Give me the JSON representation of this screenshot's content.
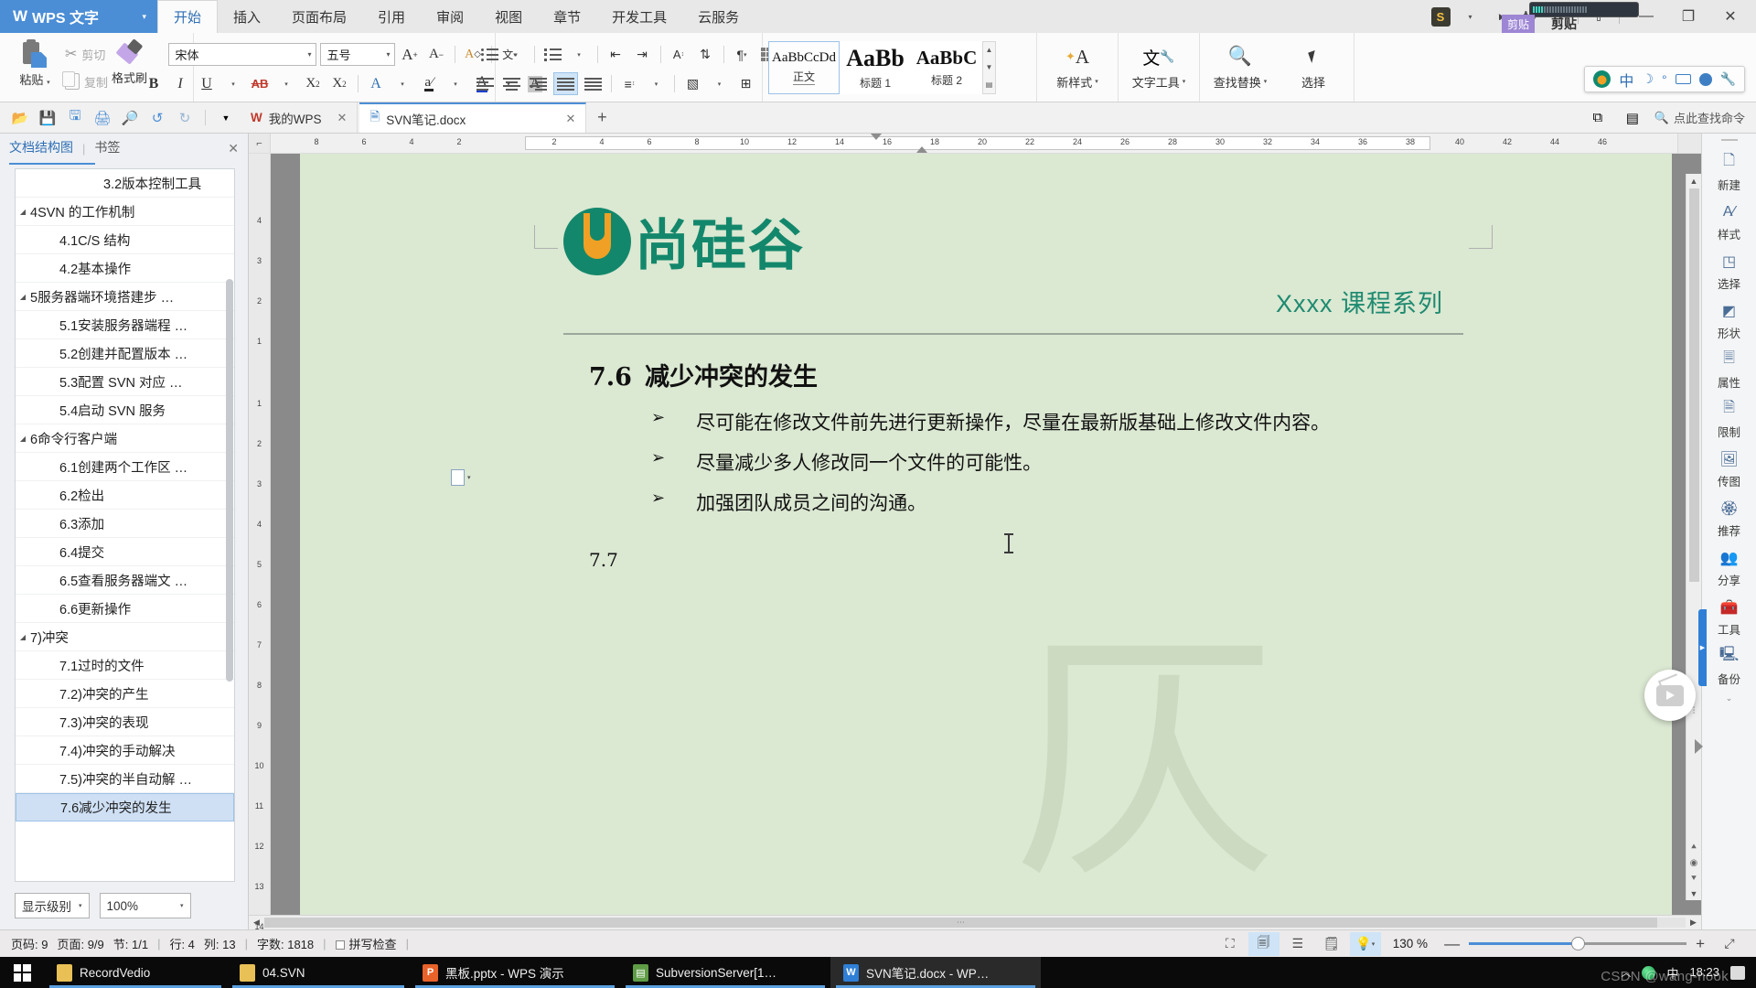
{
  "titlebar": {
    "brand": "WPS 文字",
    "brand_caret": "▾",
    "tabs": [
      {
        "label": "开始",
        "active": true
      },
      {
        "label": "插入",
        "active": false
      },
      {
        "label": "页面布局",
        "active": false
      },
      {
        "label": "引用",
        "active": false
      },
      {
        "label": "审阅",
        "active": false
      },
      {
        "label": "视图",
        "active": false
      },
      {
        "label": "章节",
        "active": false
      },
      {
        "label": "开发工具",
        "active": false
      },
      {
        "label": "云服务",
        "active": false
      }
    ],
    "rec_badge_1": "剪贴",
    "rec_badge_2": "剪贴",
    "s_badge": "S",
    "minimize": "—",
    "maximize": "❐",
    "close": "✕",
    "help": "?",
    "share": "⤒"
  },
  "ribbon": {
    "clipboard": {
      "paste": "粘贴",
      "cut": "剪切",
      "copy": "复制",
      "format_painter": "格式刷"
    },
    "font": {
      "family_value": "宋体",
      "size_value": "五号",
      "grow": "A",
      "shrink": "A",
      "clear_format": "A",
      "pinyin": "文"
    },
    "styles": [
      {
        "preview": "AaBbCcDd",
        "name": "正文",
        "active": true
      },
      {
        "preview": "AaBb",
        "name": "标题 1",
        "active": false
      },
      {
        "preview": "AaBbC",
        "name": "标题 2",
        "active": false
      }
    ],
    "tools": [
      {
        "label": "新样式",
        "icon": "new-style-icon",
        "glyph": "A"
      },
      {
        "label": "文字工具",
        "icon": "text-tools-icon",
        "glyph": "文"
      },
      {
        "label": "查找替换",
        "icon": "find-replace-icon",
        "glyph": "🔍"
      },
      {
        "label": "选择",
        "icon": "select-icon",
        "glyph": "➤"
      }
    ],
    "ime": {
      "u": "U",
      "zh": "中",
      "moon": "☽",
      "dot": "°",
      "keyboard": "⌨",
      "person": "👤",
      "wrench": "🔧"
    }
  },
  "quickbar": {
    "icons": [
      "open-icon",
      "save-icon",
      "save-as-icon",
      "print-icon",
      "print-preview-icon",
      "undo-icon",
      "redo-icon",
      "customize-icon"
    ],
    "doc_tabs": [
      {
        "label": "我的WPS",
        "active": false,
        "icon": "wps-w-icon"
      },
      {
        "label": "SVN笔记.docx",
        "active": true,
        "icon": "docx-icon"
      }
    ],
    "new_tab": "+",
    "right_icons": [
      "split-icon",
      "panel-icon"
    ],
    "search_label": "点此查找命令"
  },
  "nav": {
    "tabs": [
      {
        "label": "文档结构图",
        "active": true
      },
      {
        "label": "书签",
        "active": false
      }
    ],
    "close": "✕",
    "items": [
      {
        "label": "3.2版本控制工具",
        "level": 2,
        "twisty": "",
        "selected": false
      },
      {
        "label": "4SVN 的工作机制",
        "level": 1,
        "twisty": "◢",
        "selected": false
      },
      {
        "label": "4.1C/S 结构",
        "level": 2,
        "twisty": "",
        "selected": false
      },
      {
        "label": "4.2基本操作",
        "level": 2,
        "twisty": "",
        "selected": false
      },
      {
        "label": "5服务器端环境搭建步 …",
        "level": 1,
        "twisty": "◢",
        "selected": false
      },
      {
        "label": "5.1安装服务器端程 …",
        "level": 2,
        "twisty": "",
        "selected": false
      },
      {
        "label": "5.2创建并配置版本 …",
        "level": 2,
        "twisty": "",
        "selected": false
      },
      {
        "label": "5.3配置 SVN 对应 …",
        "level": 2,
        "twisty": "",
        "selected": false
      },
      {
        "label": "5.4启动 SVN 服务",
        "level": 2,
        "twisty": "",
        "selected": false
      },
      {
        "label": "6命令行客户端",
        "level": 1,
        "twisty": "◢",
        "selected": false
      },
      {
        "label": "6.1创建两个工作区 …",
        "level": 2,
        "twisty": "",
        "selected": false
      },
      {
        "label": "6.2检出",
        "level": 2,
        "twisty": "",
        "selected": false
      },
      {
        "label": "6.3添加",
        "level": 2,
        "twisty": "",
        "selected": false
      },
      {
        "label": "6.4提交",
        "level": 2,
        "twisty": "",
        "selected": false
      },
      {
        "label": "6.5查看服务器端文 …",
        "level": 2,
        "twisty": "",
        "selected": false
      },
      {
        "label": "6.6更新操作",
        "level": 2,
        "twisty": "",
        "selected": false
      },
      {
        "label": "7)冲突",
        "level": 1,
        "twisty": "◢",
        "selected": false
      },
      {
        "label": "7.1过时的文件",
        "level": 2,
        "twisty": "",
        "selected": false
      },
      {
        "label": "7.2)冲突的产生",
        "level": 2,
        "twisty": "",
        "selected": false
      },
      {
        "label": "7.3)冲突的表现",
        "level": 2,
        "twisty": "",
        "selected": false
      },
      {
        "label": "7.4)冲突的手动解决",
        "level": 2,
        "twisty": "",
        "selected": false
      },
      {
        "label": "7.5)冲突的半自动解 …",
        "level": 2,
        "twisty": "",
        "selected": false
      },
      {
        "label": "7.6减少冲突的发生",
        "level": 2,
        "twisty": "",
        "selected": true
      }
    ],
    "footer": {
      "display_level": "显示级别",
      "zoom": "100%",
      "caret": "▾"
    }
  },
  "document": {
    "logo_text": "尚硅谷",
    "course_series": "Xxxx 课程系列",
    "heading_num": "7.6",
    "heading_text": "减少冲突的发生",
    "bullets": [
      {
        "marker": "➢",
        "text": "尽可能在修改文件前先进行更新操作，尽量在最新版基础上修改文件内容。"
      },
      {
        "marker": "➢",
        "text": "尽量减少多人修改同一个文件的可能性。"
      },
      {
        "marker": "➢",
        "text": "加强团队成员之间的沟通。"
      }
    ],
    "next_section": "7.7",
    "watermark_char": "仄",
    "h_ruler_ticks": [
      "8",
      "6",
      "4",
      "2",
      "2",
      "4",
      "6",
      "8",
      "10",
      "12",
      "14",
      "16",
      "18",
      "20",
      "22",
      "24",
      "26",
      "28",
      "30",
      "32",
      "34",
      "36",
      "38",
      "40",
      "42",
      "44",
      "46"
    ],
    "v_ruler_ticks": [
      "4",
      "3",
      "2",
      "1",
      "1",
      "2",
      "3",
      "4",
      "5",
      "6",
      "7",
      "8",
      "9",
      "10",
      "11",
      "12",
      "13",
      "14"
    ]
  },
  "rsidebar": {
    "items": [
      {
        "label": "新建",
        "icon": "new-doc-icon",
        "glyph": "📄"
      },
      {
        "label": "样式",
        "icon": "style-icon",
        "glyph": "A"
      },
      {
        "label": "选择",
        "icon": "select-pane-icon",
        "glyph": "◳"
      },
      {
        "label": "形状",
        "icon": "shapes-icon",
        "glyph": "◗"
      },
      {
        "label": "属性",
        "icon": "properties-icon",
        "glyph": "🗏"
      },
      {
        "label": "限制",
        "icon": "restrict-icon",
        "glyph": "🗎"
      },
      {
        "label": "传图",
        "icon": "upload-image-icon",
        "glyph": "🖼"
      },
      {
        "label": "推荐",
        "icon": "recommend-icon",
        "glyph": "🏅"
      },
      {
        "label": "分享",
        "icon": "share-icon",
        "glyph": "👥"
      },
      {
        "label": "工具",
        "icon": "toolbox-icon",
        "glyph": "🧰"
      },
      {
        "label": "备份",
        "icon": "backup-icon",
        "glyph": "📷"
      }
    ],
    "chevron": "⌄"
  },
  "statusbar": {
    "page_no": "页码: 9",
    "pages": "页面: 9/9",
    "section": "节: 1/1",
    "line": "行: 4",
    "column": "列: 13",
    "word_count": "字数: 1818",
    "spellcheck": "拼写检查",
    "views": [
      {
        "icon": "full-screen-icon",
        "glyph": "⛶",
        "on": false
      },
      {
        "icon": "page-view-icon",
        "glyph": "🗐",
        "on": true
      },
      {
        "icon": "outline-view-icon",
        "glyph": "☰",
        "on": false
      },
      {
        "icon": "web-view-icon",
        "glyph": "🗒",
        "on": false
      },
      {
        "icon": "reading-view-icon",
        "glyph": "💡",
        "on": true
      }
    ],
    "zoom_level": "130 %",
    "zoom_minus": "—",
    "zoom_plus": "+",
    "fit_icon": "⤢"
  },
  "taskbar": {
    "start": "start-button",
    "items": [
      {
        "label": "RecordVedio",
        "icon": "folder-icon",
        "kind": "folder",
        "active": false
      },
      {
        "label": "04.SVN",
        "icon": "folder-icon",
        "kind": "folder",
        "active": false
      },
      {
        "label": "黑板.pptx - WPS 演示",
        "icon": "wps-ppt-icon",
        "kind": "ppt",
        "active": false
      },
      {
        "label": "SubversionServer[1…",
        "icon": "svn-server-icon",
        "kind": "svn",
        "active": false
      },
      {
        "label": "SVN笔记.docx - WP…",
        "icon": "wps-word-icon",
        "kind": "wps",
        "active": true
      }
    ],
    "tray": {
      "chevron": "︿",
      "globe": "globe-icon",
      "ime": "中",
      "time": "18:23",
      "notification": "notification-icon"
    },
    "watermark": "CSDN @wang-nook"
  },
  "colors": {
    "brand_blue": "#4b8ed6",
    "page_green": "#dbe8d2",
    "logo_teal": "#13876b",
    "logo_orange": "#f0a024",
    "nav_selected": "#cfe0f5"
  }
}
